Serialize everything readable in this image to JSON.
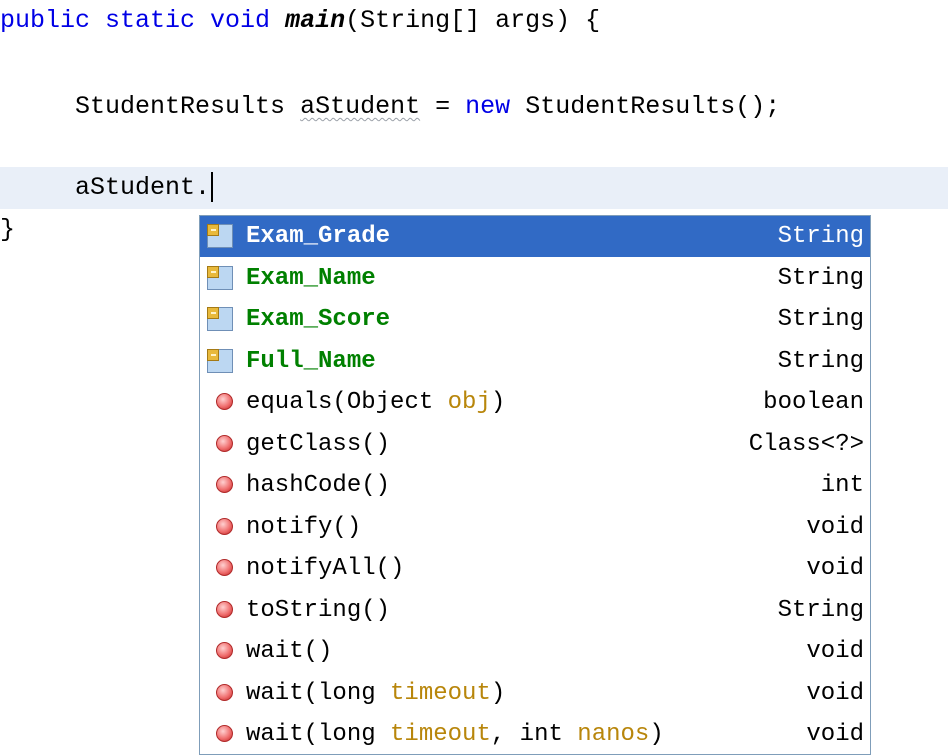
{
  "editor": {
    "line1": {
      "kw1": "public static void",
      "method": "main",
      "rest": "(String[] args) {"
    },
    "line2": {
      "type": "StudentResults",
      "var": "aStudent",
      "assign": "=",
      "kw_new": "new",
      "ctor": "StudentResults();"
    },
    "line3": {
      "text": "aStudent."
    },
    "line4": {
      "text": "}"
    }
  },
  "completion": {
    "selected_index": 0,
    "items": [
      {
        "kind": "field",
        "icon": "field-icon",
        "name": "Exam_Grade",
        "type": "String"
      },
      {
        "kind": "field",
        "icon": "field-icon",
        "name": "Exam_Name",
        "type": "String"
      },
      {
        "kind": "field",
        "icon": "field-icon",
        "name": "Exam_Score",
        "type": "String"
      },
      {
        "kind": "field",
        "icon": "field-icon",
        "name": "Full_Name",
        "type": "String"
      },
      {
        "kind": "method",
        "icon": "method-icon",
        "name": "equals",
        "params": [
          {
            "type": "Object",
            "name": "obj"
          }
        ],
        "type": "boolean"
      },
      {
        "kind": "method",
        "icon": "method-icon",
        "name": "getClass",
        "params": [],
        "type": "Class<?>"
      },
      {
        "kind": "method",
        "icon": "method-icon",
        "name": "hashCode",
        "params": [],
        "type": "int"
      },
      {
        "kind": "method",
        "icon": "method-icon",
        "name": "notify",
        "params": [],
        "type": "void"
      },
      {
        "kind": "method",
        "icon": "method-icon",
        "name": "notifyAll",
        "params": [],
        "type": "void"
      },
      {
        "kind": "method",
        "icon": "method-icon",
        "name": "toString",
        "params": [],
        "type": "String"
      },
      {
        "kind": "method",
        "icon": "method-icon",
        "name": "wait",
        "params": [],
        "type": "void"
      },
      {
        "kind": "method",
        "icon": "method-icon",
        "name": "wait",
        "params": [
          {
            "type": "long",
            "name": "timeout"
          }
        ],
        "type": "void"
      },
      {
        "kind": "method",
        "icon": "method-icon",
        "name": "wait",
        "params": [
          {
            "type": "long",
            "name": "timeout"
          },
          {
            "type": "int",
            "name": "nanos"
          }
        ],
        "type": "void"
      }
    ]
  },
  "colors": {
    "keyword": "#0000e6",
    "field_name": "#008000",
    "param_name": "#b8860b",
    "selection": "#316ac5",
    "current_line": "#e9eff8"
  }
}
